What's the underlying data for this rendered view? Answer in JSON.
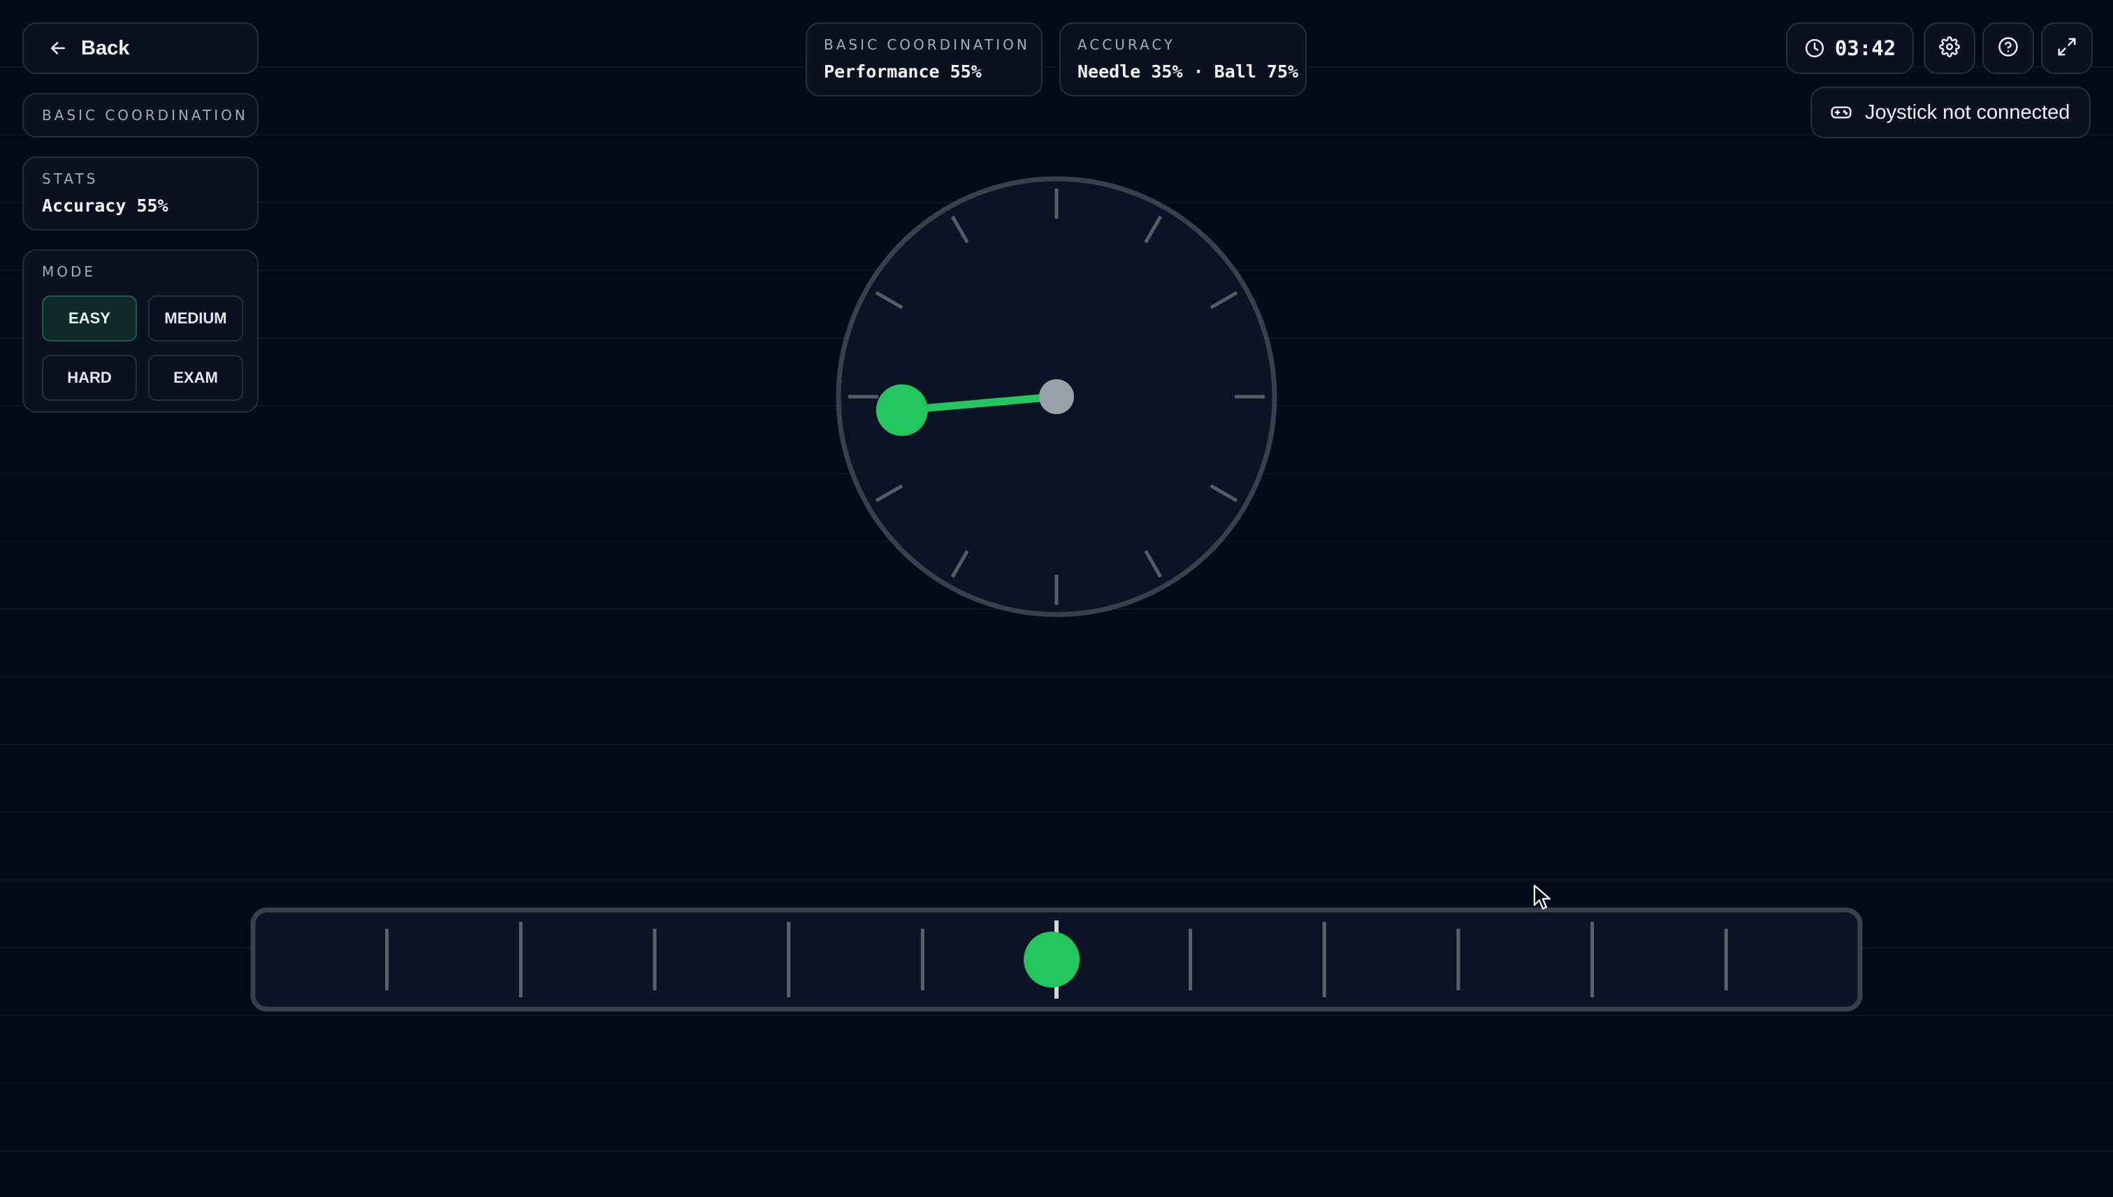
{
  "nav": {
    "back_label": "Back",
    "back_icon": "arrow-left-icon"
  },
  "sidebar": {
    "exercise_label": "BASIC COORDINATION",
    "stats_title": "STATS",
    "stats_value": "Accuracy 55%",
    "mode_title": "MODE",
    "modes": [
      {
        "label": "EASY",
        "active": true
      },
      {
        "label": "MEDIUM",
        "active": false
      },
      {
        "label": "HARD",
        "active": false
      },
      {
        "label": "EXAM",
        "active": false
      }
    ]
  },
  "header": {
    "performance_title": "BASIC COORDINATION",
    "performance_value": "Performance 55%",
    "accuracy_title": "ACCURACY",
    "accuracy_value": "Needle 35% · Ball 75%"
  },
  "toolbar": {
    "timer": "03:42",
    "timer_icon": "clock-icon",
    "settings_icon": "gear-icon",
    "help_icon": "question-circle-icon",
    "fullscreen_icon": "expand-icon",
    "joystick_status": "Joystick not connected",
    "joystick_icon": "gamepad-icon"
  },
  "game": {
    "dial": {
      "tick_count": 12,
      "needle_angle_deg": 265,
      "ball_color": "#22c55e",
      "hub_color": "#9aa0aa"
    },
    "bar": {
      "tick_count": 11,
      "ball_position_fraction": 0.497,
      "center_marker_fraction": 0.5,
      "ball_color": "#22c55e"
    }
  },
  "colors": {
    "background": "#040a18",
    "panel": "#0b1121",
    "border": "#262d3d",
    "accent": "#22c55e",
    "active_mode_bg": "#0f2a2b"
  }
}
